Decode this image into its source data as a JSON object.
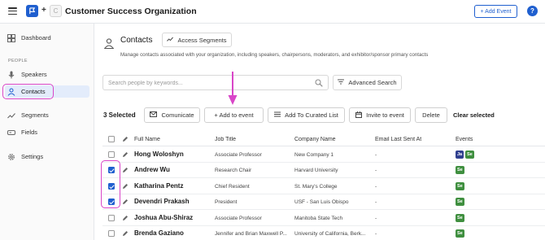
{
  "header": {
    "partner_logo_letter": "C",
    "org_title": "Customer Success Organization",
    "add_event_label": "+ Add Event",
    "help_label": "?"
  },
  "sidebar": {
    "items_top": [
      {
        "label": "Dashboard",
        "icon": "dashboard-icon"
      }
    ],
    "section_label": "PEOPLE",
    "people_items": [
      {
        "label": "Speakers",
        "icon": "microphone-icon"
      },
      {
        "label": "Contacts",
        "icon": "person-icon",
        "active": true
      }
    ],
    "items_bottom": [
      {
        "label": "Segments",
        "icon": "trend-icon"
      },
      {
        "label": "Fields",
        "icon": "field-icon"
      },
      {
        "label": "Settings",
        "icon": "gear-icon"
      }
    ]
  },
  "main": {
    "title": "Contacts",
    "segments_button": "Access Segments",
    "subtitle": "Manage contacts associated with your organization, including speakers, chairpersons, moderators, and exhibitor/sponsor primary contacts",
    "search_placeholder": "Search people by keywords...",
    "advanced_search": "Advanced Search"
  },
  "toolbar": {
    "selected_count": "3 Selected",
    "communicate": "Comunicate",
    "add_to_event": "+ Add to event",
    "add_to_list": "Add To Curated List",
    "invite": "Invite to event",
    "delete": "Delete",
    "clear": "Clear selected"
  },
  "table": {
    "columns": [
      "Full Name",
      "Job Title",
      "Company Name",
      "Email Last Sent At",
      "Events"
    ],
    "rows": [
      {
        "name": "Hong Woloshyn",
        "job": "Associate Professor",
        "company": "New Company 1",
        "email": "-",
        "checked": false,
        "badges": [
          {
            "text": "Ja",
            "color": "#2f3f8f"
          },
          {
            "text": "Se",
            "color": "#3f8f3f"
          }
        ]
      },
      {
        "name": "Andrew Wu",
        "job": "Research Chair",
        "company": "Harvard University",
        "email": "-",
        "checked": true,
        "badges": [
          {
            "text": "Se",
            "color": "#3f8f3f"
          }
        ]
      },
      {
        "name": "Katharina Pentz",
        "job": "Chief Resident",
        "company": "St. Mary's College",
        "email": "-",
        "checked": true,
        "badges": [
          {
            "text": "Se",
            "color": "#3f8f3f"
          }
        ]
      },
      {
        "name": "Devendri Prakash",
        "job": "President",
        "company": "USF - San Luis Obispo",
        "email": "-",
        "checked": true,
        "badges": [
          {
            "text": "Se",
            "color": "#3f8f3f"
          }
        ]
      },
      {
        "name": "Joshua Abu-Shiraz",
        "job": "Associate Professor",
        "company": "Manitoba State Tech",
        "email": "-",
        "checked": false,
        "badges": [
          {
            "text": "Se",
            "color": "#3f8f3f"
          }
        ]
      },
      {
        "name": "Brenda Gaziano",
        "job": "Jennifer and Brian Maxwell P...",
        "company": "University of California, Berk...",
        "email": "-",
        "checked": false,
        "badges": [
          {
            "text": "Se",
            "color": "#3f8f3f"
          }
        ]
      }
    ]
  },
  "colors": {
    "accent": "#1f5fcf",
    "highlight": "#d946c8",
    "sidebar_active": "#e3ecfb"
  }
}
